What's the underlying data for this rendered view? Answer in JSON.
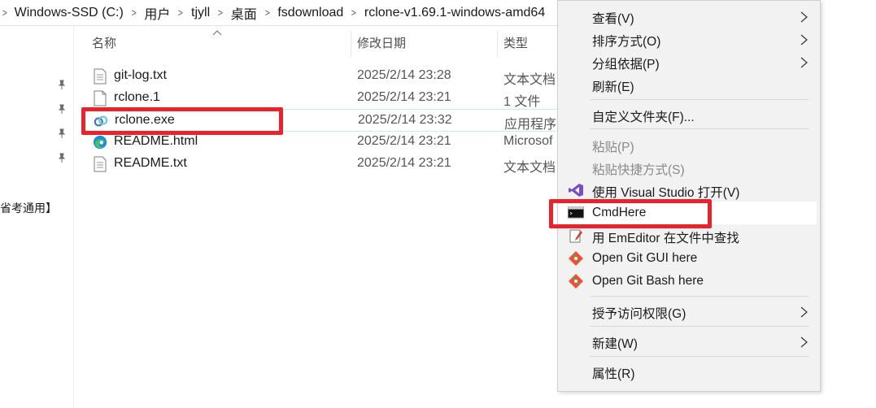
{
  "address_bar": {
    "segments": [
      "Windows-SSD (C:)",
      "用户",
      "tjyll",
      "桌面",
      "fsdownload",
      "rclone-v1.69.1-windows-amd64"
    ]
  },
  "nav": {
    "partial_text": "省考通用】"
  },
  "columns": {
    "name": "名称",
    "date": "修改日期",
    "type": "类型"
  },
  "files": [
    {
      "name": "git-log.txt",
      "date": "2025/2/14 23:28",
      "type": "文本文档",
      "icon": "text-file-icon"
    },
    {
      "name": "rclone.1",
      "date": "2025/2/14 23:21",
      "type": "1 文件",
      "icon": "file-icon"
    },
    {
      "name": "rclone.exe",
      "date": "2025/2/14 23:32",
      "type": "应用程序",
      "icon": "rclone-app-icon"
    },
    {
      "name": "README.html",
      "date": "2025/2/14 23:21",
      "type": "Microsof",
      "icon": "edge-icon"
    },
    {
      "name": "README.txt",
      "date": "2025/2/14 23:21",
      "type": "文本文档",
      "icon": "text-file-icon"
    }
  ],
  "context_menu": {
    "view": "查看(V)",
    "sort": "排序方式(O)",
    "group": "分组依据(P)",
    "refresh": "刷新(E)",
    "customize": "自定义文件夹(F)...",
    "paste": "粘贴(P)",
    "paste_shortcut": "粘贴快捷方式(S)",
    "open_vs": "使用 Visual Studio 打开(V)",
    "cmdhere": "CmdHere",
    "emeditor": "用 EmEditor 在文件中查找",
    "git_gui": "Open Git GUI here",
    "git_bash": "Open Git Bash here",
    "grant_access": "授予访问权限(G)",
    "new": "新建(W)",
    "properties": "属性(R)"
  },
  "colors": {
    "highlight_box": "#e8232c",
    "menu_bg": "#f2f2f2",
    "selection_border": "#cce8ff"
  }
}
